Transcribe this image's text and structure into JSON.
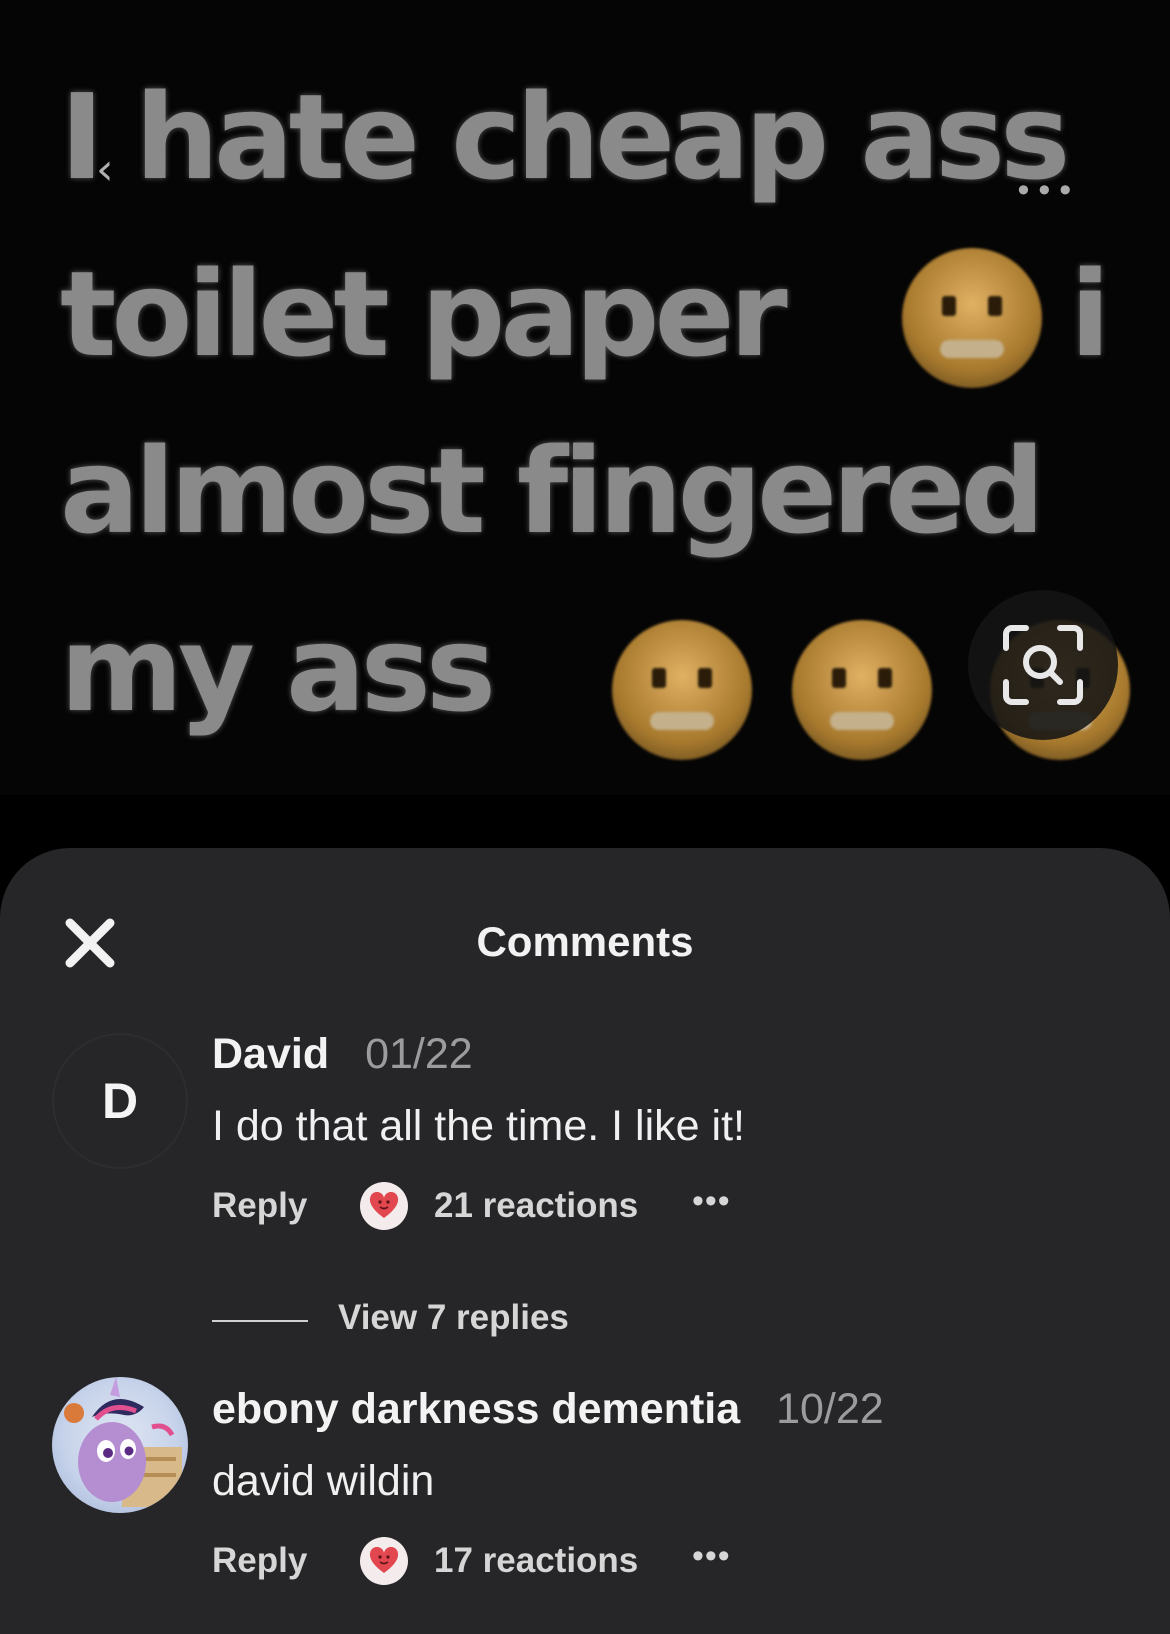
{
  "meme": {
    "line1": "I hate cheap ass",
    "line2": "toilet paper",
    "line2_tail": "i",
    "line3": "almost fingered",
    "line4": "my ass",
    "emoji": "angry-face"
  },
  "sheet": {
    "title": "Comments",
    "close_icon": "close-icon"
  },
  "comments": [
    {
      "avatar_letter": "D",
      "author": "David",
      "date": "01/22",
      "text": "I do that all the time. I like it!",
      "reply_label": "Reply",
      "reactions": "21 reactions",
      "more": "•••",
      "view_replies": "View 7 replies"
    },
    {
      "avatar_icon": "pony-avatar",
      "author": "ebony darkness dementia",
      "date": "10/22",
      "text": "david wildin",
      "reply_label": "Reply",
      "reactions": "17 reactions",
      "more": "•••"
    }
  ],
  "colors": {
    "sheet_bg": "#262628",
    "text_primary": "#f2f2f2",
    "text_muted": "#9c9c9f",
    "heart": "#e2474f"
  }
}
